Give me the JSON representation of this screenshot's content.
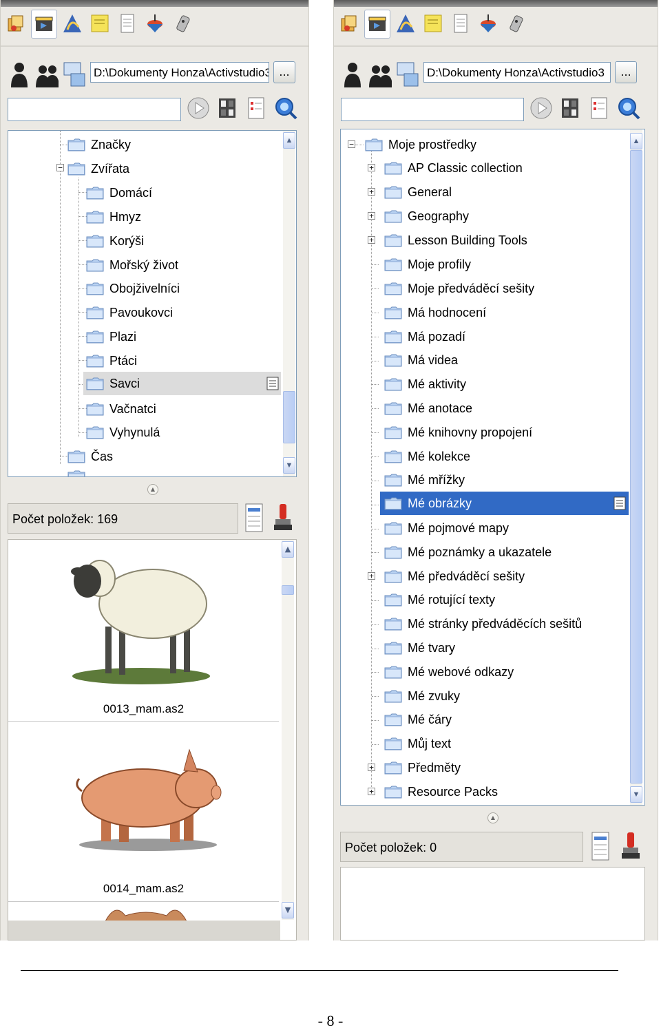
{
  "left": {
    "path": "D:\\Dokumenty Honza\\Activstudio3",
    "browse_label": "...",
    "tree": [
      {
        "label": "Značky"
      },
      {
        "label": "Zvířata"
      },
      {
        "label": "Domácí"
      },
      {
        "label": "Hmyz"
      },
      {
        "label": "Korýši"
      },
      {
        "label": "Mořský život"
      },
      {
        "label": "Obojživelníci"
      },
      {
        "label": "Pavoukovci"
      },
      {
        "label": "Plazi"
      },
      {
        "label": "Ptáci"
      },
      {
        "label": "Savci"
      },
      {
        "label": "Vačnatci"
      },
      {
        "label": "Vyhynulá"
      },
      {
        "label": "Čas"
      }
    ],
    "count_label": "Počet položek: 169",
    "thumbnails": [
      {
        "label": "0013_mam.as2"
      },
      {
        "label": "0014_mam.as2"
      }
    ]
  },
  "right": {
    "path": "D:\\Dokumenty Honza\\Activstudio3",
    "browse_label": "...",
    "tree": [
      {
        "label": "Moje prostředky"
      },
      {
        "label": "AP Classic collection"
      },
      {
        "label": "General"
      },
      {
        "label": "Geography"
      },
      {
        "label": "Lesson Building Tools"
      },
      {
        "label": "Moje profily"
      },
      {
        "label": "Moje předváděcí sešity"
      },
      {
        "label": "Má hodnocení"
      },
      {
        "label": "Má pozadí"
      },
      {
        "label": "Má videa"
      },
      {
        "label": "Mé aktivity"
      },
      {
        "label": "Mé anotace"
      },
      {
        "label": "Mé knihovny propojení"
      },
      {
        "label": "Mé kolekce"
      },
      {
        "label": "Mé mřížky"
      },
      {
        "label": "Mé obrázky"
      },
      {
        "label": "Mé pojmové mapy"
      },
      {
        "label": "Mé poznámky a ukazatele"
      },
      {
        "label": "Mé předváděcí sešity"
      },
      {
        "label": "Mé rotující texty"
      },
      {
        "label": "Mé stránky předváděcích sešitů"
      },
      {
        "label": "Mé tvary"
      },
      {
        "label": "Mé webové odkazy"
      },
      {
        "label": "Mé zvuky"
      },
      {
        "label": "Mé čáry"
      },
      {
        "label": "Můj text"
      },
      {
        "label": "Předměty"
      },
      {
        "label": "Resource Packs"
      }
    ],
    "count_label": "Počet položek: 0"
  },
  "page_number": "- 8 -",
  "colors": {
    "selection": "#316ac5",
    "folder": "#a9c6ec",
    "field_border": "#7f9db9"
  }
}
